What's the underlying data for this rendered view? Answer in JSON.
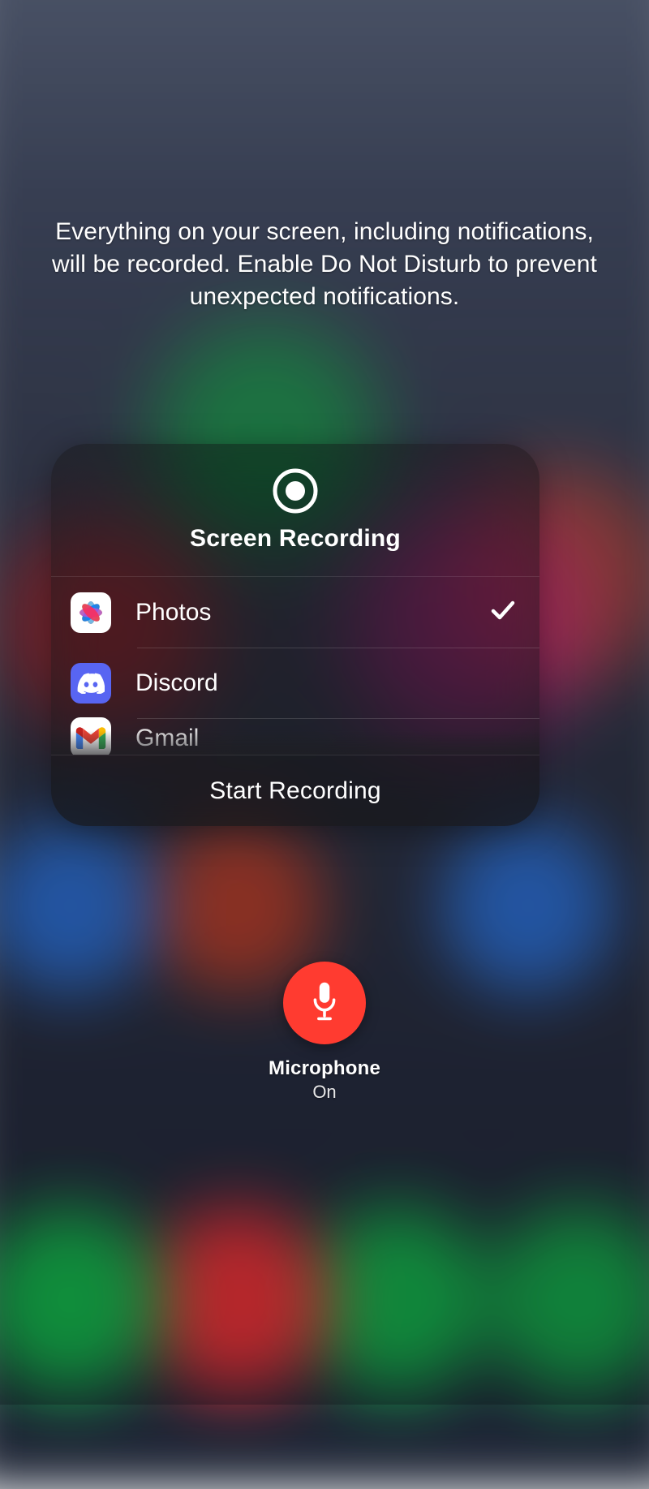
{
  "info_text": "Everything on your screen, including notifications, will be recorded. Enable Do Not Disturb to prevent unexpected notifications.",
  "panel": {
    "title": "Screen Recording",
    "start_label": "Start Recording"
  },
  "apps": [
    {
      "label": "Photos",
      "icon": "photos",
      "selected": true
    },
    {
      "label": "Discord",
      "icon": "discord",
      "selected": false
    },
    {
      "label": "Gmail",
      "icon": "gmail",
      "selected": false
    }
  ],
  "microphone": {
    "label": "Microphone",
    "state": "On"
  }
}
